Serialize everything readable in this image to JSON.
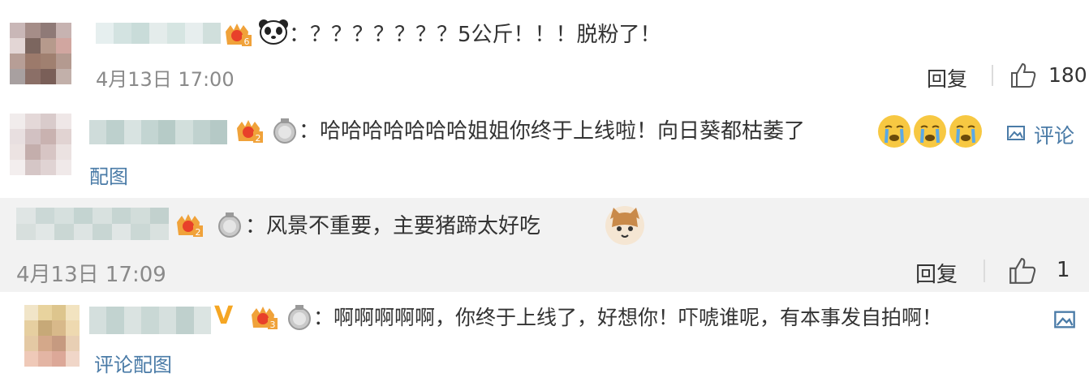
{
  "comments": [
    {
      "text": "：？？？？？？？5公斤！！！脱粉了！",
      "date": "4月13日 17:00",
      "reply": "回复",
      "likes": "180",
      "badge_level": "6"
    },
    {
      "text": "：哈哈哈哈哈哈哈姐姐你终于上线啦！向日葵都枯萎了",
      "action": "评论",
      "image_link": "配图",
      "badge_level": "2"
    },
    {
      "text": "：风景不重要，主要猪蹄太好吃",
      "date": "4月13日 17:09",
      "reply": "回复",
      "likes": "1",
      "badge_level": "2"
    },
    {
      "text": "：啊啊啊啊啊，你终于上线了，好想你！吓唬谁呢，有本事发自拍啊！",
      "vip": "V",
      "image_link": "评论配图",
      "badge_level": "3"
    }
  ],
  "icons": {
    "like": "thumbs-up-icon",
    "image": "image-icon",
    "medal": "silver-medal-icon",
    "fan_badge": "fan-badge-icon"
  },
  "colors": {
    "text": "#333333",
    "meta": "#8a8a8a",
    "link": "#4a7ba7",
    "band": "#f2f2f2",
    "badge": "#f0a23a",
    "vip": "#f5a623"
  }
}
